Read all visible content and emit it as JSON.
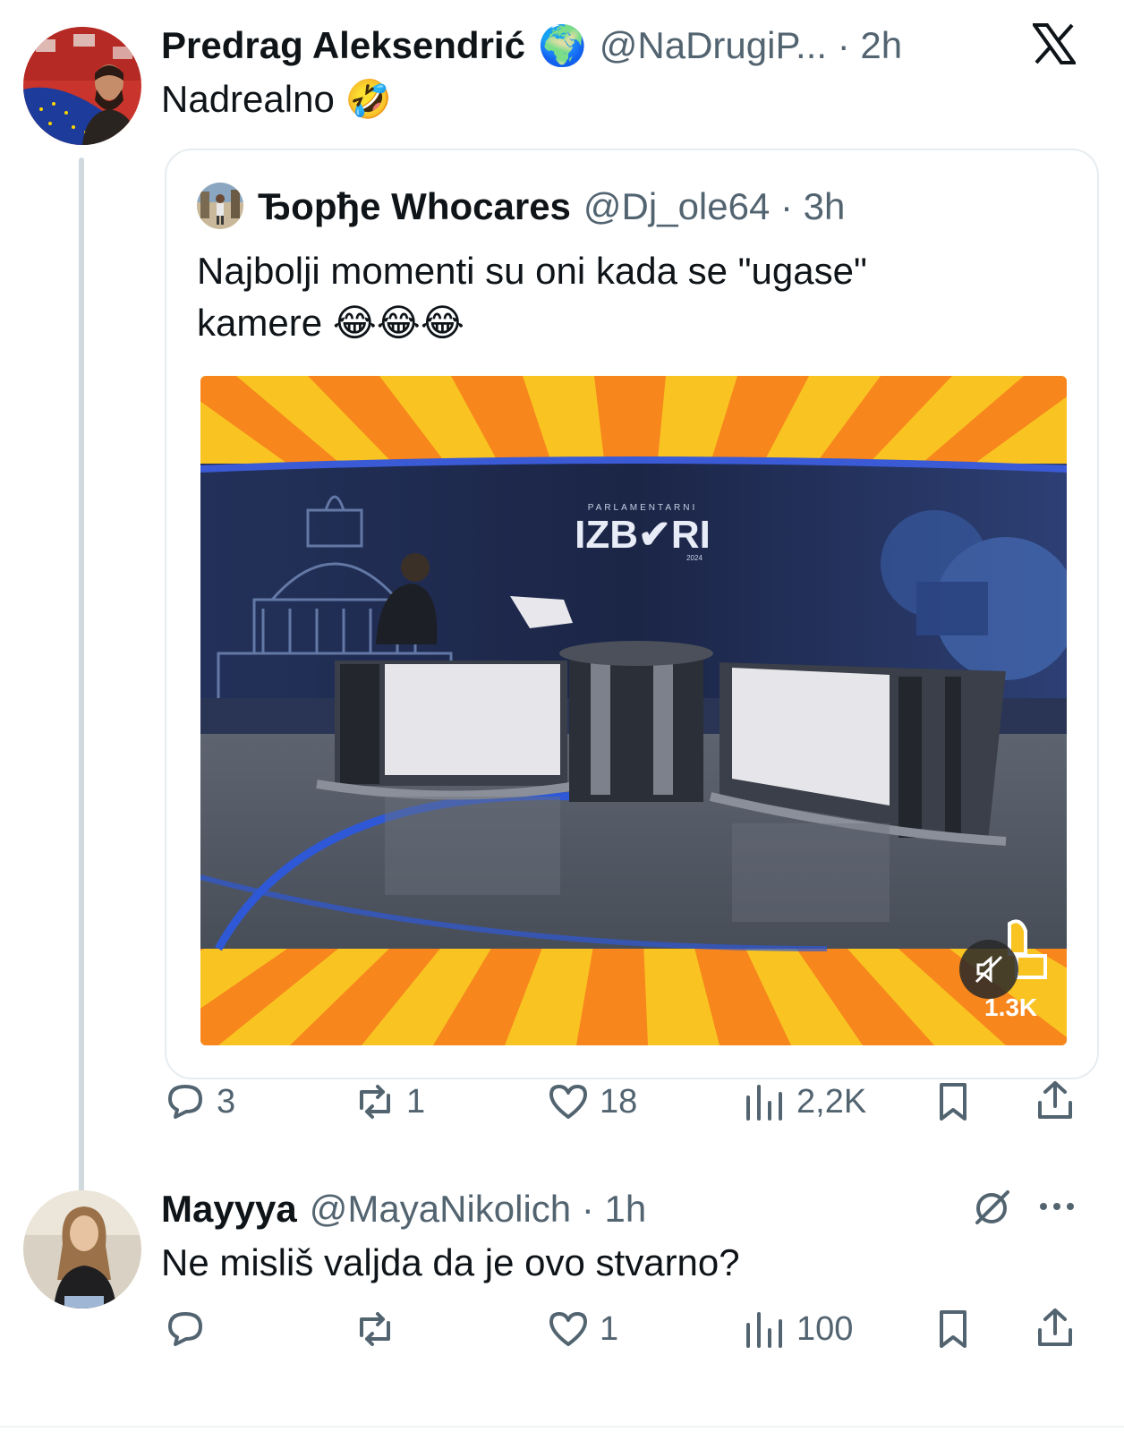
{
  "main_tweet": {
    "author_name": "Predrag Aleksendrić",
    "handle_time": "@NaDrugiP... · 2h",
    "text": "Nadrealno 🤣",
    "globe_badge": "🌍",
    "platform_logo": "x-logo-icon"
  },
  "quoted_tweet": {
    "author_name": "Ђорђе Whocares",
    "handle_time": "@Dj_ole64 · 3h",
    "text_line1": "Najbolji momenti su oni kada se \"ugase\"",
    "text_line2": "kamere 😂😂😂",
    "media": {
      "studio_sign_small": "PARLAMENTARNI",
      "studio_sign_big": "IZB✔RI",
      "studio_sign_year": "2024",
      "overlay_count": "1.3K",
      "mute_icon": "speaker-muted-icon",
      "like_icon": "thumbs-up-icon"
    }
  },
  "main_actions": {
    "reply_count": "3",
    "retweet_count": "1",
    "like_count": "18",
    "views_count": "2,2K"
  },
  "reply_tweet": {
    "author_name": "Mayyya",
    "handle_time": "@MayaNikolich · 1h",
    "text": "Ne misliš valjda da je ovo stvarno?",
    "actions": {
      "reply_count": "",
      "retweet_count": "",
      "like_count": "1",
      "views_count": "100"
    }
  },
  "colors": {
    "text_primary": "#0f1419",
    "text_secondary": "#536471",
    "border": "#e6ecf0",
    "thread_line": "#cfd9de",
    "stripe_orange": "#f7861c",
    "stripe_yellow": "#f9c322",
    "studio_navy": "#1e2a4d"
  }
}
